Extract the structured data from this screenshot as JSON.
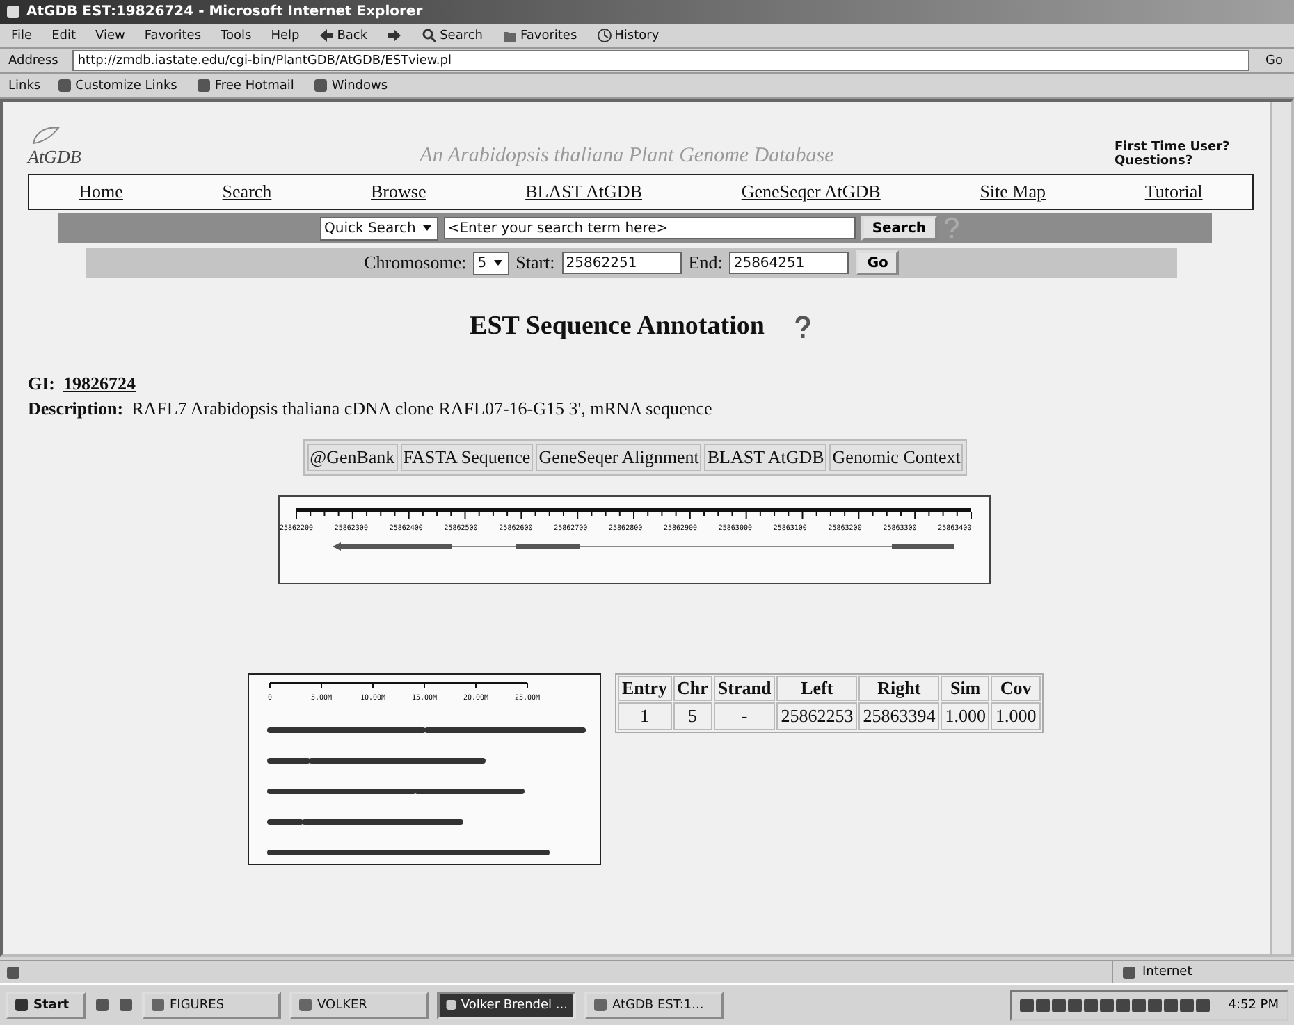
{
  "window": {
    "title": "AtGDB EST:19826724 - Microsoft Internet Explorer"
  },
  "menu": [
    "File",
    "Edit",
    "View",
    "Favorites",
    "Tools",
    "Help"
  ],
  "toolbar": [
    {
      "label": "Back",
      "kind": "back"
    },
    {
      "kind": "forward"
    },
    {
      "label": "Search",
      "kind": "search"
    },
    {
      "label": "Favorites",
      "kind": "favorites"
    },
    {
      "label": "History",
      "kind": "history"
    }
  ],
  "address": {
    "label": "Address",
    "value": "http://zmdb.iastate.edu/cgi-bin/PlantGDB/AtGDB/ESTview.pl",
    "go": "Go"
  },
  "links": {
    "label": "Links",
    "items": [
      "Customize Links",
      "Free Hotmail",
      "Windows"
    ]
  },
  "site": {
    "logo": "AtGDB",
    "tagline": "An Arabidopsis thaliana Plant Genome Database",
    "help": [
      "First Time User?",
      "Questions?"
    ]
  },
  "nav": [
    "Home",
    "Search",
    "Browse",
    "BLAST AtGDB",
    "GeneSeqer AtGDB",
    "Site Map",
    "Tutorial"
  ],
  "quick_search": {
    "mode": "Quick Search",
    "value": "<Enter your search term here>",
    "button": "Search"
  },
  "range": {
    "chromosome_label": "Chromosome:",
    "chromosome": "5",
    "start_label": "Start:",
    "start": "25862251",
    "end_label": "End:",
    "end": "25864251",
    "button": "Go"
  },
  "heading": "EST Sequence Annotation",
  "gi": {
    "label": "GI:",
    "value": "19826724"
  },
  "description": {
    "label": "Description:",
    "value": "RAFL7 Arabidopsis thaliana cDNA clone RAFL07-16-G15 3', mRNA sequence"
  },
  "tabs": [
    "@GenBank",
    "FASTA Sequence",
    "GeneSeqer Alignment",
    "BLAST AtGDB",
    "Genomic Context"
  ],
  "ruler": {
    "labels": [
      "25862200",
      "25862300",
      "25862400",
      "25862500",
      "25862600",
      "25862700",
      "25862800",
      "25862900",
      "25863000",
      "25863100",
      "25863200",
      "25863300",
      "25863400"
    ]
  },
  "overview": {
    "labels": [
      "0",
      "5.00M",
      "10.00M",
      "15.00M",
      "20.00M",
      "25.00M"
    ]
  },
  "table": {
    "columns": [
      "Entry",
      "Chr",
      "Strand",
      "Left",
      "Right",
      "Sim",
      "Cov"
    ],
    "rows": [
      [
        "1",
        "5",
        "-",
        "25862253",
        "25863394",
        "1.000",
        "1.000"
      ]
    ]
  },
  "status_bar": {
    "zone": "Internet"
  },
  "taskbar": {
    "start": "Start",
    "tasks": [
      {
        "label": "FIGURES",
        "selected": false
      },
      {
        "label": "VOLKER",
        "selected": false
      },
      {
        "label": "Volker Brendel ...",
        "selected": true
      },
      {
        "label": "AtGDB EST:1...",
        "selected": false
      }
    ],
    "clock": "4:52 PM"
  }
}
